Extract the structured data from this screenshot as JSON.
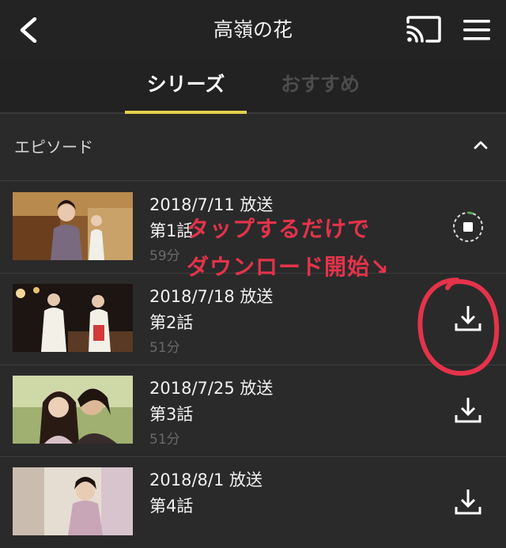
{
  "header": {
    "title": "高嶺の花",
    "back_icon": "chevron-left-icon",
    "cast_icon": "cast-icon",
    "menu_icon": "hamburger-menu-icon"
  },
  "tabs": [
    {
      "label": "シリーズ",
      "selected": true
    },
    {
      "label": "おすすめ",
      "selected": false
    }
  ],
  "section": {
    "label": "エピソード",
    "icon": "chevron-up-icon"
  },
  "episodes": [
    {
      "date": "2018/7/11 放送",
      "number": "第1話",
      "duration": "59分",
      "status": "downloading",
      "action_icon": "stop-download-icon"
    },
    {
      "date": "2018/7/18 放送",
      "number": "第2話",
      "duration": "51分",
      "status": "not-downloaded",
      "action_icon": "download-icon"
    },
    {
      "date": "2018/7/25 放送",
      "number": "第3話",
      "duration": "51分",
      "status": "not-downloaded",
      "action_icon": "download-icon"
    },
    {
      "date": "2018/8/1 放送",
      "number": "第4話",
      "duration": "",
      "status": "not-downloaded",
      "action_icon": "download-icon"
    }
  ],
  "annotation": {
    "line1": "タップするだけで",
    "line2": "ダウンロード開始↘",
    "color": "#e4334a"
  },
  "colors": {
    "background": "#2a2a2a",
    "header": "#232323",
    "tab_accent": "#e3d14b",
    "download_progress": "#4caf50"
  }
}
